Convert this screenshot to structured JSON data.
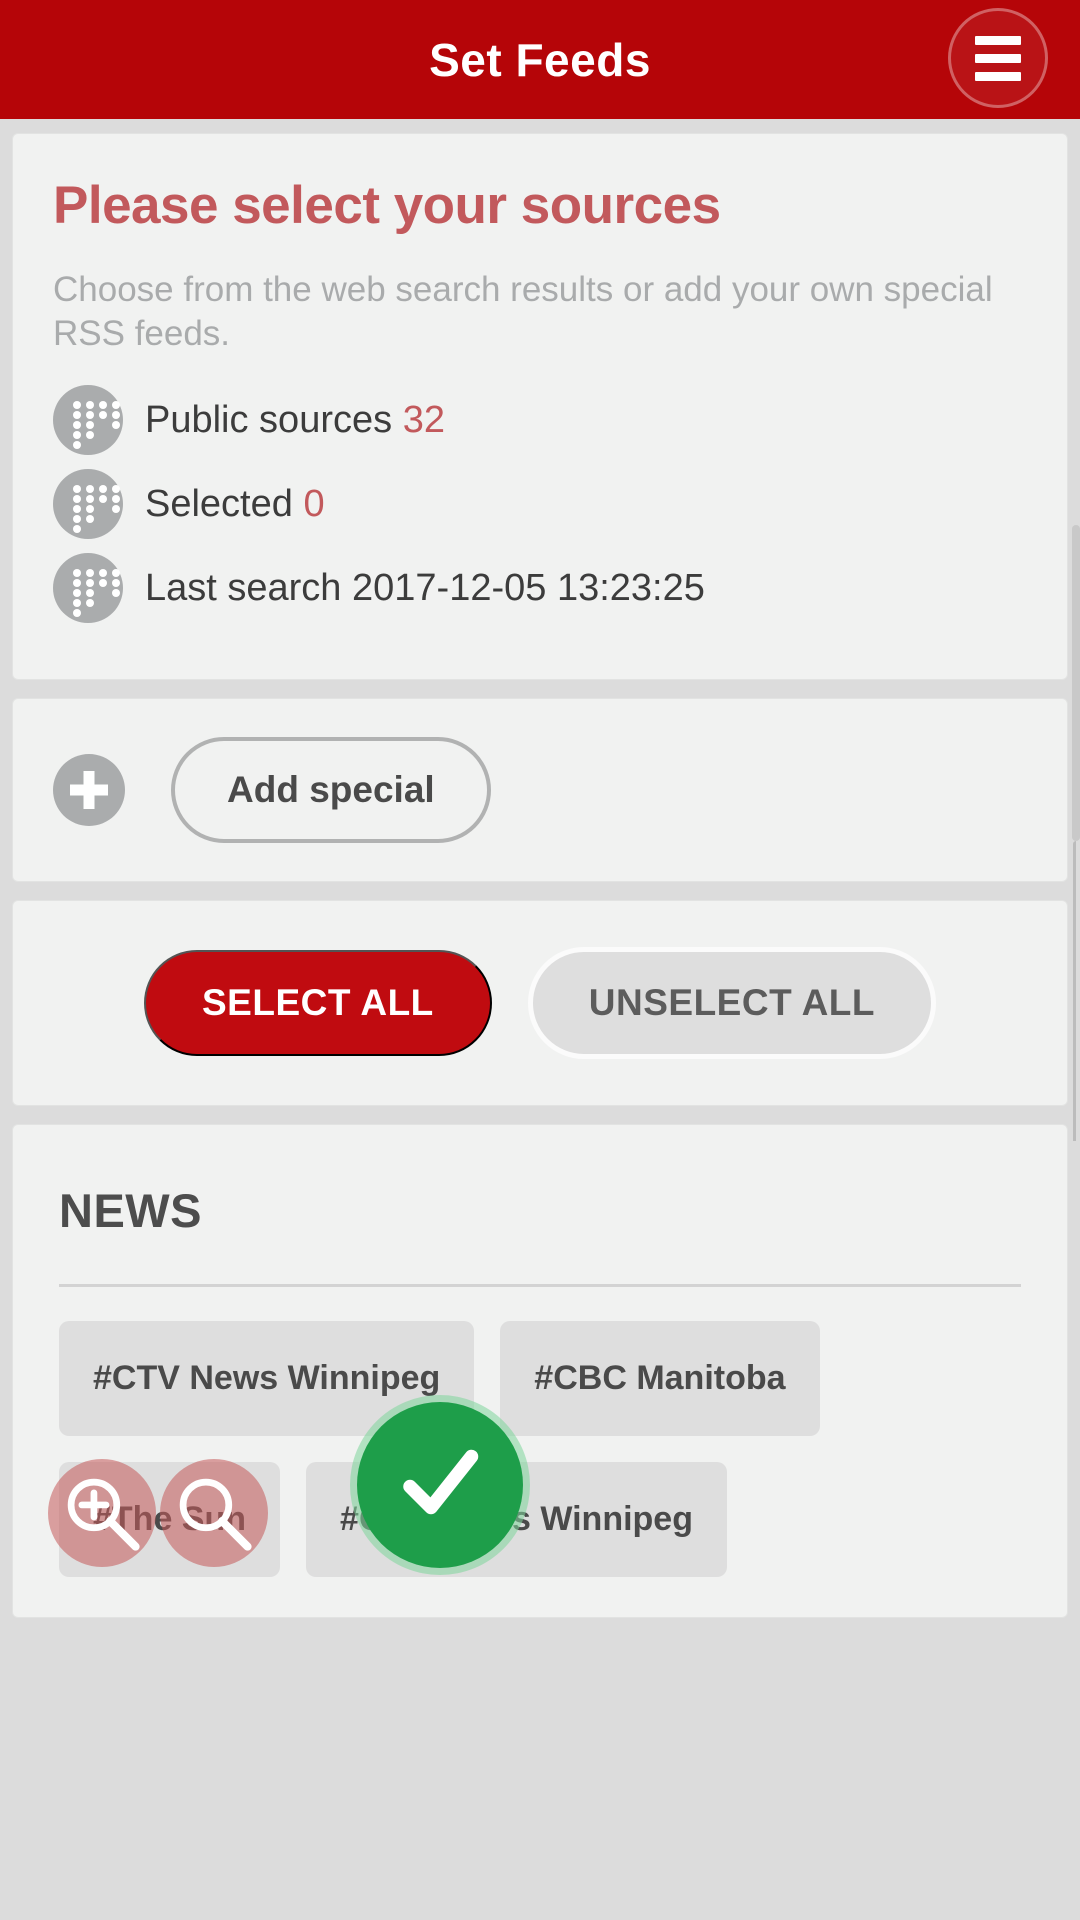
{
  "header": {
    "title": "Set Feeds",
    "menu_icon": "hamburger-menu-icon",
    "background_color": "#b50508"
  },
  "intro": {
    "title": "Please select your sources",
    "subtitle": "Choose from the web search results or add your own special RSS feeds.",
    "title_color": "#c2595c",
    "stats": [
      {
        "label": "Public sources",
        "value": "32",
        "icon": "dots-pattern-icon"
      },
      {
        "label": "Selected",
        "value": "0",
        "icon": "dots-pattern-icon"
      },
      {
        "label": "Last search",
        "value": "2017-12-05 13:23:25",
        "icon": "dots-pattern-icon"
      }
    ]
  },
  "add_special": {
    "plus_icon": "plus-icon",
    "label": "Add special"
  },
  "selection_actions": {
    "select_all_label": "SELECT ALL",
    "unselect_all_label": "UNSELECT ALL",
    "select_all_color": "#c00b10",
    "unselect_all_color": "#dedede"
  },
  "news_section": {
    "title": "NEWS",
    "chips": [
      {
        "label": "#CTV News Winnipeg",
        "width": "w1"
      },
      {
        "label": "#CBC Manitoba",
        "width": "w2"
      },
      {
        "label": "#The Sun",
        "width": "w3"
      },
      {
        "label": "#CBC News Winnipeg",
        "width": "w4"
      }
    ]
  },
  "overlays": {
    "confirm_fab": {
      "icon": "check-icon",
      "color": "#1e9e4a"
    },
    "zoom_in_button": {
      "icon": "magnifier-plus-icon"
    },
    "zoom_button": {
      "icon": "magnifier-icon"
    }
  }
}
